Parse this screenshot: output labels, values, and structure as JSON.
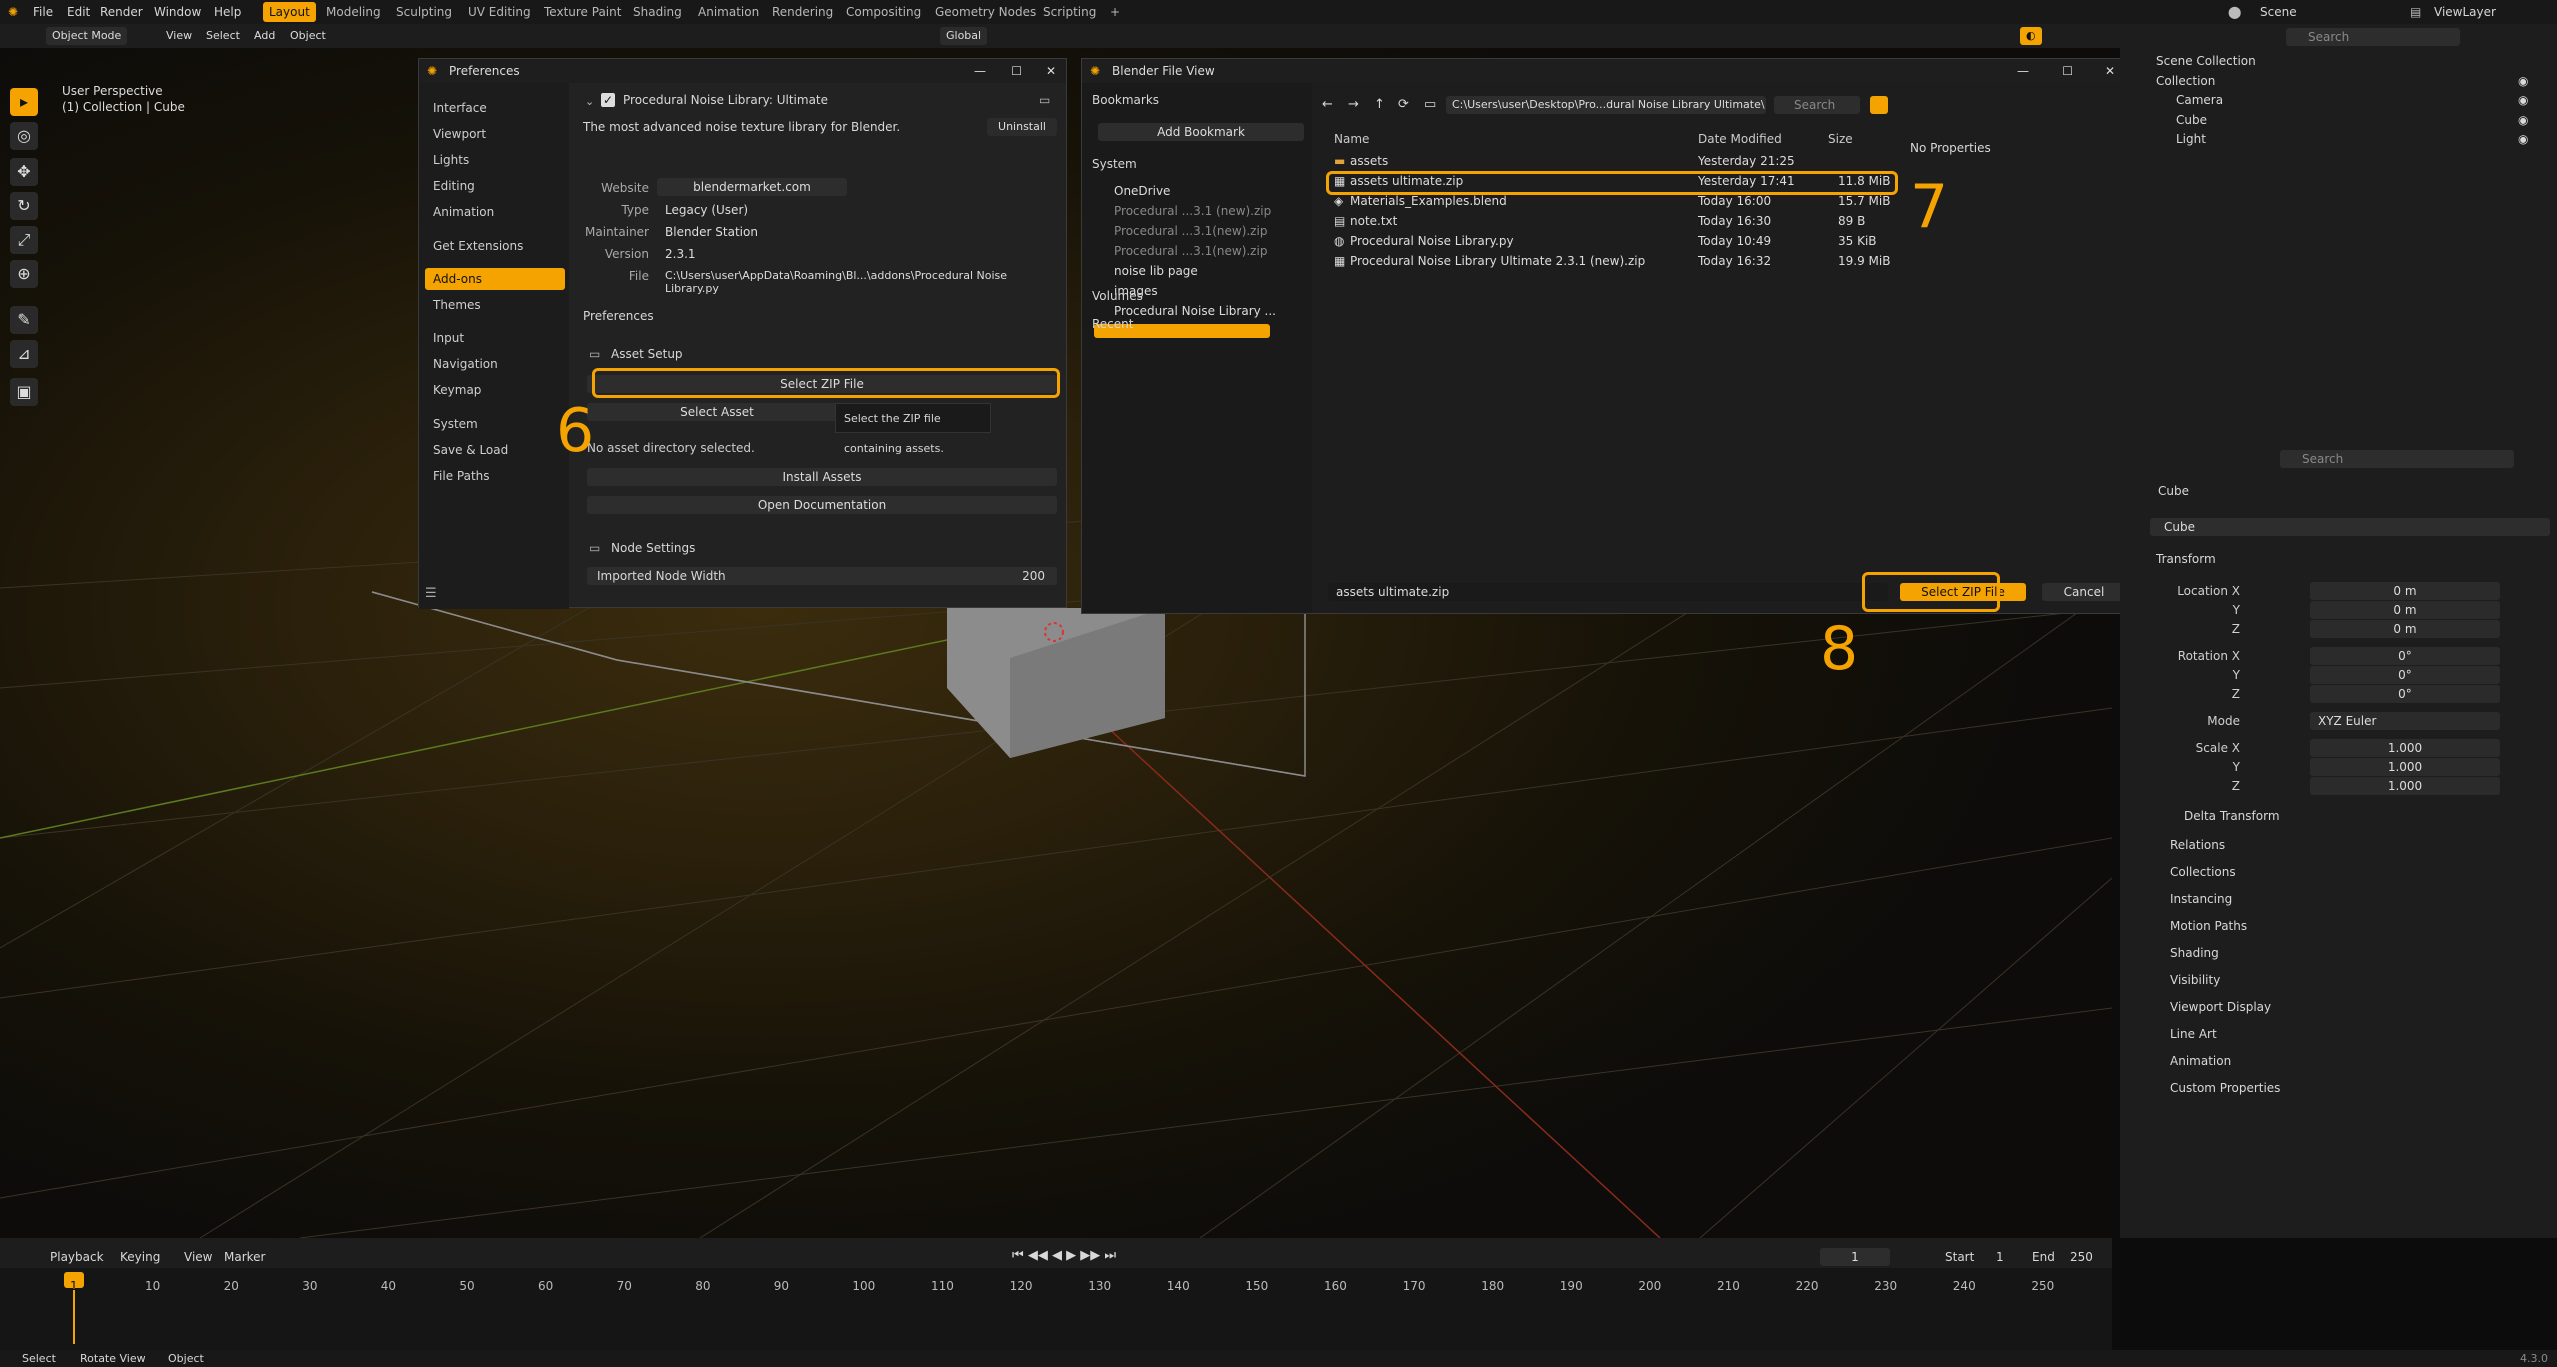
{
  "topbar": {
    "menus": [
      "File",
      "Edit",
      "Render",
      "Window",
      "Help"
    ],
    "workspaces": [
      "Layout",
      "Modeling",
      "Sculpting",
      "UV Editing",
      "Texture Paint",
      "Shading",
      "Animation",
      "Rendering",
      "Compositing",
      "Geometry Nodes",
      "Scripting"
    ],
    "add_tab": "+",
    "scene": "Scene",
    "view_layer": "ViewLayer"
  },
  "viewport_header": {
    "mode": "Object Mode",
    "menus": [
      "View",
      "Select",
      "Add",
      "Object"
    ],
    "orientation": "Global"
  },
  "viewport": {
    "view_name": "User Perspective",
    "collection_info": "(1) Collection | Cube"
  },
  "preferences": {
    "title": "Preferences",
    "sidebar": [
      "Interface",
      "Viewport",
      "Lights",
      "Editing",
      "Animation",
      "Get Extensions",
      "Add-ons",
      "Themes",
      "Input",
      "Navigation",
      "Keymap",
      "System",
      "Save & Load",
      "File Paths"
    ],
    "active_item": "Add-ons",
    "addon_name": "Procedural Noise Library: Ultimate",
    "description": "The most advanced noise texture library for Blender.",
    "uninstall": "Uninstall",
    "fields": [
      {
        "label": "Website",
        "value": "blendermarket.com"
      },
      {
        "label": "Type",
        "value": "Legacy (User)"
      },
      {
        "label": "Maintainer",
        "value": "Blender Station"
      },
      {
        "label": "Version",
        "value": "2.3.1"
      },
      {
        "label": "File",
        "value": "C:\\Users\\user\\AppData\\Roaming\\Bl...\\addons\\Procedural Noise Library.py"
      }
    ],
    "prefs_heading": "Preferences",
    "asset_setup": "Asset Setup",
    "select_zip": "Select ZIP File",
    "select_asset": "Select Asset",
    "tooltip": "Select the ZIP file containing assets.",
    "no_dir": "No asset directory selected.",
    "install_assets": "Install Assets",
    "open_docs": "Open Documentation",
    "node_settings": "Node Settings",
    "imported_node_width_label": "Imported Node Width",
    "imported_node_width_value": "200"
  },
  "file_view": {
    "title": "Blender File View",
    "bookmarks": "Bookmarks",
    "add_bookmark": "Add Bookmark",
    "system": "System",
    "system_items": [
      "OneDrive",
      "Procedural ...3.1 (new).zip",
      "Procedural ...3.1(new).zip",
      "Procedural ...3.1(new).zip",
      "noise lib page",
      "images",
      "Procedural Noise Library ..."
    ],
    "volumes": "Volumes",
    "recent": "Recent",
    "path": "C:\\Users\\user\\Desktop\\Pro...dural Noise Library Ultimate\\",
    "search_placeholder": "Search",
    "columns": [
      "Name",
      "Date Modified",
      "Size"
    ],
    "files": [
      {
        "name": "assets",
        "date": "Yesterday 21:25",
        "size": ""
      },
      {
        "name": "assets ultimate.zip",
        "date": "Yesterday 17:41",
        "size": "11.8 MiB"
      },
      {
        "name": "Materials_Examples.blend",
        "date": "Today 16:00",
        "size": "15.7 MiB"
      },
      {
        "name": "note.txt",
        "date": "Today 16:30",
        "size": "89 B"
      },
      {
        "name": "Procedural Noise Library.py",
        "date": "Today 10:49",
        "size": "35 KiB"
      },
      {
        "name": "Procedural Noise Library Ultimate  2.3.1 (new).zip",
        "date": "Today 16:32",
        "size": "19.9 MiB"
      }
    ],
    "no_properties": "No Properties",
    "filename": "assets ultimate.zip",
    "select_zip": "Select ZIP File",
    "cancel": "Cancel"
  },
  "annotations": [
    "6",
    "7",
    "8"
  ],
  "outliner": {
    "search": "Search",
    "scene_collection": "Scene Collection",
    "items": [
      "Collection",
      "Camera",
      "Cube",
      "Light"
    ]
  },
  "properties": {
    "search": "Search",
    "object": "Cube",
    "object_name": "Cube",
    "transform": "Transform",
    "location_label": "Location X",
    "location": [
      "0 m",
      "0 m",
      "0 m"
    ],
    "rotation_label": "Rotation X",
    "rotation": [
      "0°",
      "0°",
      "0°"
    ],
    "axis_y": "Y",
    "axis_z": "Z",
    "mode_label": "Mode",
    "mode": "XYZ Euler",
    "scale_label": "Scale X",
    "scale": [
      "1.000",
      "1.000",
      "1.000"
    ],
    "sections": [
      "Delta Transform",
      "Relations",
      "Collections",
      "Instancing",
      "Motion Paths",
      "Shading",
      "Visibility",
      "Viewport Display",
      "Line Art",
      "Animation",
      "Custom Properties"
    ]
  },
  "timeline": {
    "menus": [
      "Playback",
      "Keying",
      "View",
      "Marker"
    ],
    "current_frame": "1",
    "start_label": "Start",
    "start": "1",
    "end_label": "End",
    "end": "250",
    "ticks": [
      "1",
      "10",
      "20",
      "30",
      "40",
      "50",
      "60",
      "70",
      "80",
      "90",
      "100",
      "110",
      "120",
      "130",
      "140",
      "150",
      "160",
      "170",
      "180",
      "190",
      "200",
      "210",
      "220",
      "230",
      "240",
      "250"
    ]
  },
  "statusbar": {
    "items": [
      "Select",
      "Rotate View",
      "Object"
    ],
    "version": "4.3.0"
  },
  "colors": {
    "accent": "#f5a300",
    "panel": "#222222",
    "bg": "#0c0c0c"
  }
}
